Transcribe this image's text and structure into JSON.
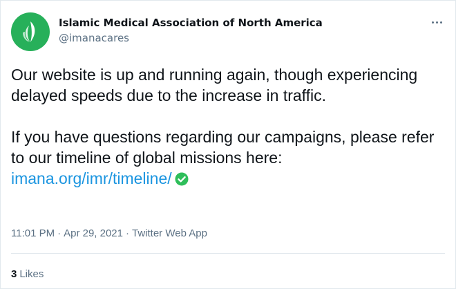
{
  "tweet": {
    "author": {
      "display_name": "Islamic Medical Association of North America",
      "handle": "@imanacares",
      "avatar_icon": "imana-flame-logo-icon",
      "avatar_color": "#27b05a"
    },
    "more_icon": "more-options-icon",
    "text": {
      "paragraph1": "Our website is up and running again, though experiencing delayed speeds due to the increase in traffic.",
      "paragraph2": "If you have questions regarding our campaigns, please refer to our timeline of global missions here:",
      "link": "imana.org/imr/timeline/",
      "link_emoji_icon": "check-mark-button-icon",
      "link_color": "#1b95e0",
      "emoji_color": "#2ebe5a"
    },
    "meta": {
      "time": "11:01 PM",
      "separator": "·",
      "date": "Apr 29, 2021",
      "source": "Twitter Web App"
    },
    "stats": {
      "likes_count": "3",
      "likes_label": "Likes"
    }
  }
}
